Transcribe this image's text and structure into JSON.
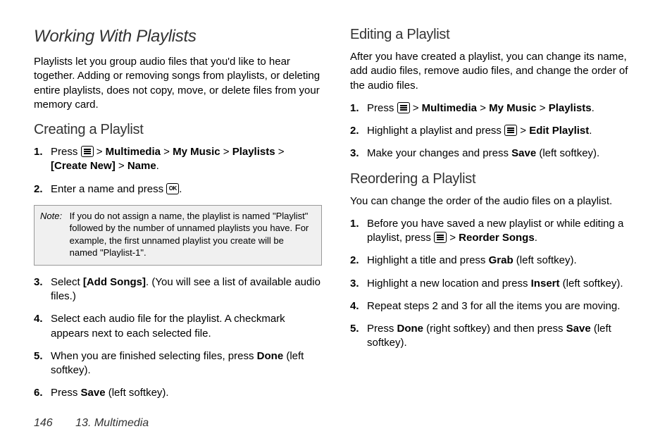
{
  "title": "Working With Playlists",
  "intro": "Playlists let you group audio files that you'd like to hear together. Adding or removing songs from playlists, or deleting entire playlists, does not copy, move, or delete files from your memory card.",
  "creating": {
    "heading": "Creating a Playlist",
    "step1_a": "Press ",
    "path1_multimedia": "Multimedia",
    "path1_mymusic": "My Music",
    "path1_playlists": "Playlists",
    "path1_createnew": "[Create New]",
    "path1_name": "Name",
    "step1_dot": ".",
    "step2_a": "Enter a name and press ",
    "step2_dot": ".",
    "note_label": "Note:",
    "note_body": "If you do not assign a name, the playlist is named \"Playlist\" followed by the number of unnamed playlists you have. For example, the first unnamed playlist you create will be named \"Playlist-1\".",
    "step3_a": "Select ",
    "step3_bold": "[Add Songs]",
    "step3_b": ". (You will see a list of available audio files.)",
    "step4": "Select each audio file for the playlist. A checkmark appears next to each selected file.",
    "step5_a": "When you are finished selecting files, press ",
    "step5_bold": "Done",
    "step5_b": " (left softkey).",
    "step6_a": "Press ",
    "step6_bold": "Save",
    "step6_b": " (left softkey)."
  },
  "editing": {
    "heading": "Editing a Playlist",
    "intro": "After you have created a playlist, you can change its name, add audio files, remove audio files, and change the order of the audio files.",
    "step1_a": "Press ",
    "path_multimedia": "Multimedia",
    "path_mymusic": "My Music",
    "path_playlists": "Playlists",
    "step1_dot": ".",
    "step2_a": "Highlight a playlist and press ",
    "step2_bold": "Edit Playlist",
    "step2_dot": ".",
    "step3_a": "Make your changes and press ",
    "step3_bold": "Save",
    "step3_b": " (left softkey)."
  },
  "reordering": {
    "heading": "Reordering a Playlist",
    "intro": "You can change the order of the audio files on a playlist.",
    "step1_a": "Before you have saved a new playlist or while editing a playlist, press ",
    "step1_bold": "Reorder Songs",
    "step1_dot": ".",
    "step2_a": "Highlight a title and press ",
    "step2_bold": "Grab",
    "step2_b": " (left softkey).",
    "step3_a": "Highlight a new location and press ",
    "step3_bold": "Insert",
    "step3_b": " (left softkey).",
    "step4": "Repeat steps 2 and 3 for all the items you are moving.",
    "step5_a": "Press ",
    "step5_bold1": "Done",
    "step5_b": " (right softkey) and then press ",
    "step5_bold2": "Save",
    "step5_c": " (left softkey)."
  },
  "gt": ">",
  "footer": {
    "page": "146",
    "section": "13. Multimedia"
  }
}
